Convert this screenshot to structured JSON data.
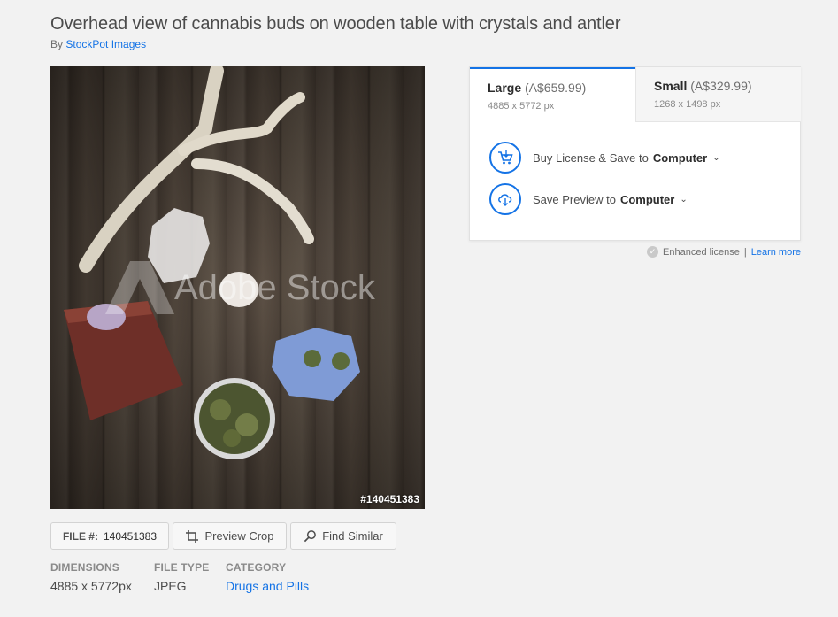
{
  "asset": {
    "title": "Overhead view of cannabis buds on wooden table with crystals and antler",
    "by_prefix": "By",
    "author": "StockPot Images",
    "watermark": "Adobe Stock",
    "photo_id": "#140451383"
  },
  "actions_bar": {
    "file_label": "FILE #:",
    "file_value": "140451383",
    "preview_crop": "Preview Crop",
    "find_similar": "Find Similar"
  },
  "details": [
    {
      "heading": "DIMENSIONS",
      "value": "4885 x 5772px"
    },
    {
      "heading": "FILE TYPE",
      "value": "JPEG"
    },
    {
      "heading": "CATEGORY",
      "value": "Drugs and Pills"
    }
  ],
  "license_panel": {
    "tabs": [
      {
        "name": "Large",
        "price": "(A$659.99)",
        "dims": "4885 x 5772 px",
        "selected": true
      },
      {
        "name": "Small",
        "price": "(A$329.99)",
        "dims": "1268 x 1498 px",
        "selected": false
      }
    ],
    "buy": {
      "label": "Buy License & Save to",
      "target": "Computer"
    },
    "preview": {
      "label": "Save Preview to",
      "target": "Computer"
    },
    "enhanced_license": "Enhanced license",
    "separator": "|",
    "learn_more": "Learn more"
  },
  "colors": {
    "accent": "#1473e6",
    "background": "#f2f2f2"
  }
}
